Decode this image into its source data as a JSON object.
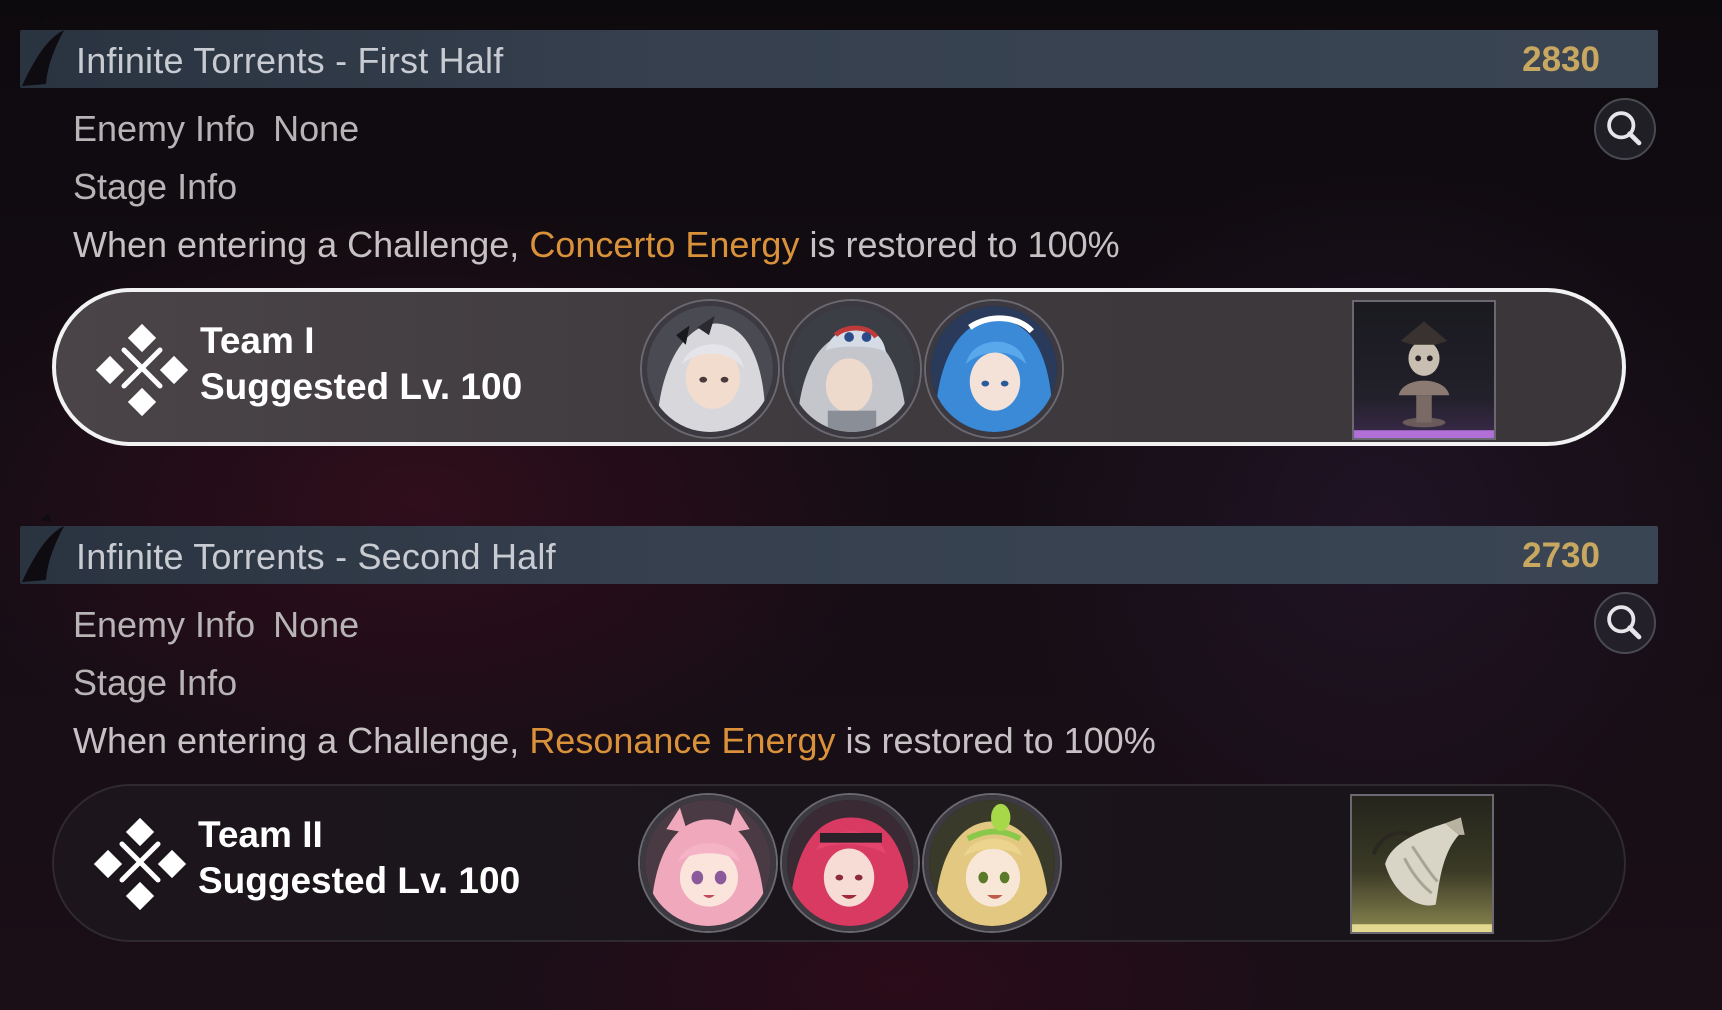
{
  "sections": [
    {
      "title": "Infinite Torrents - First Half",
      "score": "2830",
      "enemy_label": "Enemy Info",
      "enemy_value": "None",
      "stage_label": "Stage Info",
      "desc_prefix": "When entering a Challenge,",
      "desc_highlight": "Concerto Energy",
      "desc_suffix": "is restored to 100%",
      "team": {
        "name": "Team I",
        "level": "Suggested Lv. 100",
        "selected": true,
        "members": [
          "silver-haired-character-portrait",
          "masked-character-portrait",
          "blue-haired-character-portrait"
        ],
        "reward_icon": "skull-bust-trophy-icon",
        "reward_color": "#b070d8"
      }
    },
    {
      "title": "Infinite Torrents - Second Half",
      "score": "2730",
      "enemy_label": "Enemy Info",
      "enemy_value": "None",
      "stage_label": "Stage Info",
      "desc_prefix": "When entering a Challenge,",
      "desc_highlight": "Resonance Energy",
      "desc_suffix": "is restored to 100%",
      "team": {
        "name": "Team II",
        "level": "Suggested Lv. 100",
        "selected": false,
        "members": [
          "pink-haired-character-portrait",
          "red-haired-character-portrait",
          "blonde-haired-character-portrait"
        ],
        "reward_icon": "horn-item-icon",
        "reward_color": "#e2d890"
      }
    }
  ],
  "colors": {
    "score": "#c8a860",
    "highlight": "#d9923a",
    "header_bar": "#36404e"
  }
}
